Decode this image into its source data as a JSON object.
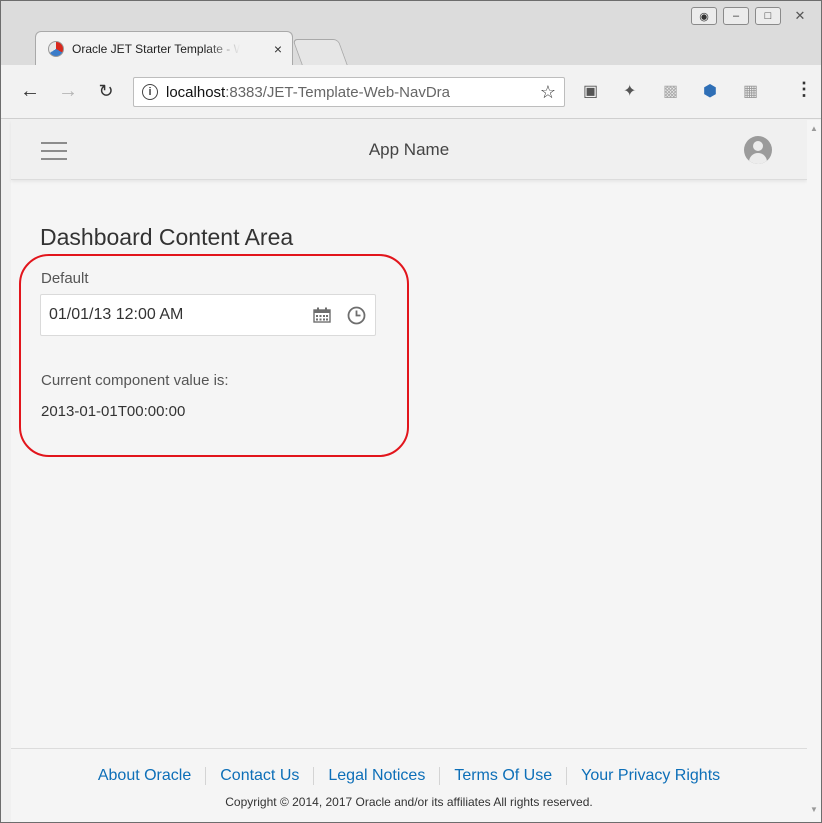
{
  "browser": {
    "tab_title": "Oracle JET Starter Template - Web Nav Drawer",
    "tab_close": "×",
    "url_host": "localhost",
    "url_rest": ":8383/JET-Template-Web-NavDra"
  },
  "app": {
    "name": "App Name"
  },
  "content": {
    "title": "Dashboard Content Area",
    "field_label": "Default",
    "datetime_value": "01/01/13 12:00 AM",
    "current_label": "Current component value is:",
    "current_value": "2013-01-01T00:00:00"
  },
  "footer": {
    "links": [
      "About Oracle",
      "Contact Us",
      "Legal Notices",
      "Terms Of Use",
      "Your Privacy Rights"
    ],
    "copyright": "Copyright © 2014, 2017 Oracle and/or its affiliates All rights reserved."
  },
  "colors": {
    "annotation": "#e2151c",
    "link": "#0d6fb8"
  }
}
